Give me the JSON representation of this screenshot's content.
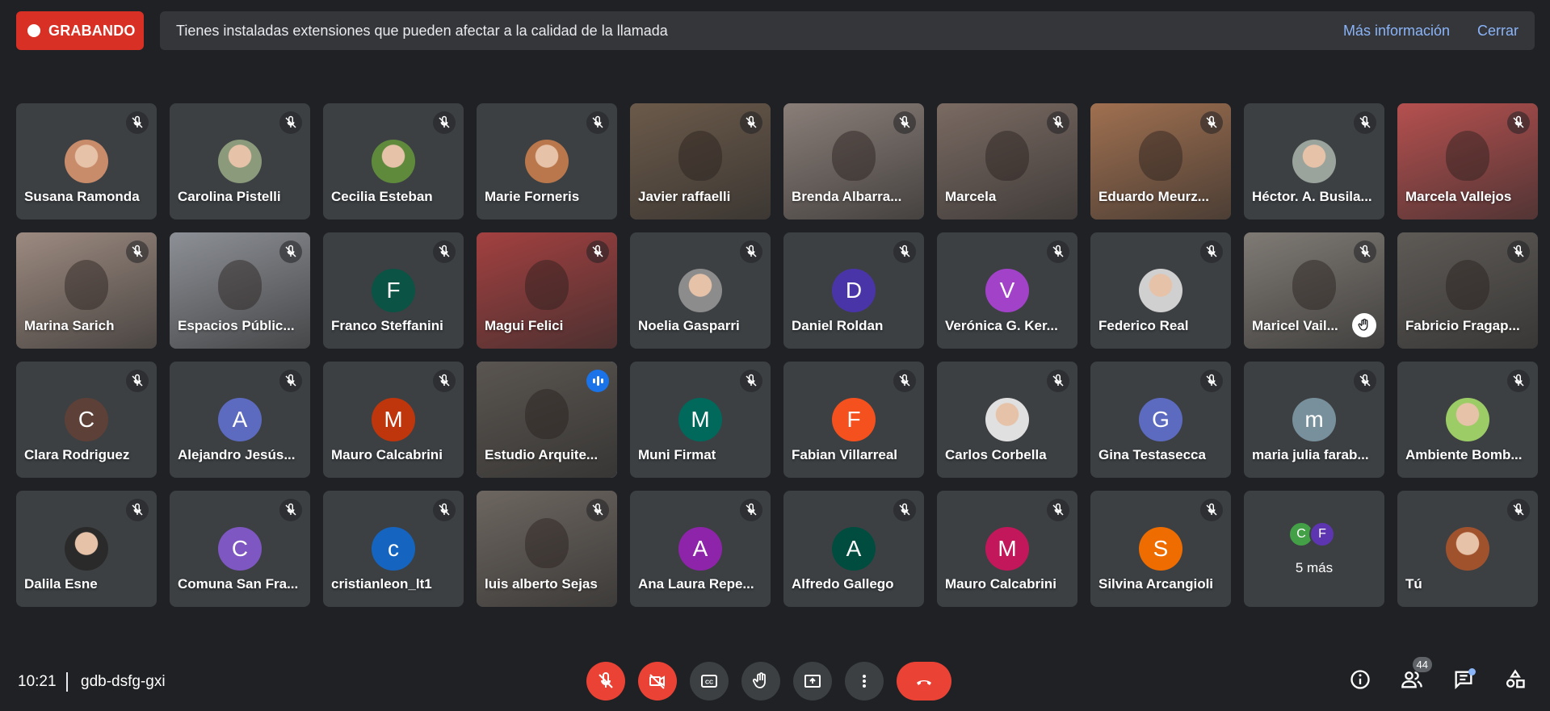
{
  "banner": {
    "recording_label": "GRABANDO",
    "notice_text": "Tienes instaladas extensiones que pueden afectar a la calidad de la llamada",
    "more_info_label": "Más información",
    "close_label": "Cerrar"
  },
  "colors": {
    "record_red": "#d93025",
    "link_blue": "#8ab4f8",
    "tile_bg": "#3c4043",
    "speaking_blue": "#1a73e8"
  },
  "participants": [
    {
      "name": "Susana Ramonda",
      "kind": "photo",
      "color": "#c98c6b"
    },
    {
      "name": "Carolina Pistelli",
      "kind": "photo",
      "color": "#8a9a7a"
    },
    {
      "name": "Cecilia Esteban",
      "kind": "photo",
      "color": "#5f8a3c"
    },
    {
      "name": "Marie Forneris",
      "kind": "photo",
      "color": "#b9774b"
    },
    {
      "name": "Javier raffaelli",
      "kind": "video",
      "color": "#6b5a4a"
    },
    {
      "name": "Brenda Albarra...",
      "kind": "video",
      "color": "#8a7e78"
    },
    {
      "name": "Marcela",
      "kind": "video",
      "color": "#7a6a62"
    },
    {
      "name": "Eduardo Meurz...",
      "kind": "video",
      "color": "#a07050"
    },
    {
      "name": "Héctor. A. Busila...",
      "kind": "photo",
      "color": "#9aa39c"
    },
    {
      "name": "Marcela Vallejos",
      "kind": "video",
      "color": "#b5504f"
    },
    {
      "name": "Marina Sarich",
      "kind": "video",
      "color": "#9c8a80"
    },
    {
      "name": "Espacios Públic...",
      "kind": "video",
      "color": "#8d9096"
    },
    {
      "name": "Franco Steffanini",
      "kind": "letter",
      "letter": "F",
      "color": "#0b5345"
    },
    {
      "name": "Magui Felici",
      "kind": "video",
      "color": "#a34040"
    },
    {
      "name": "Noelia Gasparri",
      "kind": "photo",
      "color": "#8c8c8c"
    },
    {
      "name": "Daniel Roldan",
      "kind": "letter",
      "letter": "D",
      "color": "#4a35a8"
    },
    {
      "name": "Verónica G. Ker...",
      "kind": "letter",
      "letter": "V",
      "color": "#a142c9"
    },
    {
      "name": "Federico Real",
      "kind": "photo",
      "color": "#d0d0d0"
    },
    {
      "name": "Maricel Vail...",
      "kind": "video",
      "color": "#7f7a74",
      "hand": true
    },
    {
      "name": "Fabricio Fragap...",
      "kind": "video",
      "color": "#5e5a56"
    },
    {
      "name": "Clara Rodriguez",
      "kind": "letter",
      "letter": "C",
      "color": "#5d4037"
    },
    {
      "name": "Alejandro Jesús...",
      "kind": "letter",
      "letter": "A",
      "color": "#5c6bc0"
    },
    {
      "name": "Mauro Calcabrini",
      "kind": "letter",
      "letter": "M",
      "color": "#bf360c"
    },
    {
      "name": "Estudio Arquite...",
      "kind": "video",
      "color": "#5a5550",
      "speaking": true
    },
    {
      "name": "Muni Firmat",
      "kind": "letter",
      "letter": "M",
      "color": "#00695c"
    },
    {
      "name": "Fabian Villarreal",
      "kind": "letter",
      "letter": "F",
      "color": "#f4511e"
    },
    {
      "name": "Carlos Corbella",
      "kind": "photo",
      "color": "#e0e0e0"
    },
    {
      "name": "Gina Testasecca",
      "kind": "letter",
      "letter": "G",
      "color": "#5c6bc0"
    },
    {
      "name": "maria julia farab...",
      "kind": "letter",
      "letter": "m",
      "color": "#78909c"
    },
    {
      "name": "Ambiente Bomb...",
      "kind": "photo",
      "color": "#9ccc65"
    },
    {
      "name": "Dalila Esne",
      "kind": "photo",
      "color": "#2a2a2a"
    },
    {
      "name": "Comuna San Fra...",
      "kind": "letter",
      "letter": "C",
      "color": "#7e57c2"
    },
    {
      "name": "cristianleon_lt1",
      "kind": "letter",
      "letter": "c",
      "color": "#1565c0"
    },
    {
      "name": "luis alberto Sejas",
      "kind": "video",
      "color": "#6d6660"
    },
    {
      "name": "Ana Laura Repe...",
      "kind": "letter",
      "letter": "A",
      "color": "#8e24aa"
    },
    {
      "name": "Alfredo Gallego",
      "kind": "letter",
      "letter": "A",
      "color": "#004d40"
    },
    {
      "name": "Mauro Calcabrini",
      "kind": "letter",
      "letter": "M",
      "color": "#c2185b"
    },
    {
      "name": "Silvina Arcangioli",
      "kind": "letter",
      "letter": "S",
      "color": "#ef6c00"
    },
    {
      "name": "5 más",
      "kind": "more",
      "letters": [
        "C",
        "F"
      ],
      "colors": [
        "#43a047",
        "#5e35b1"
      ]
    },
    {
      "name": "Tú",
      "kind": "photo",
      "color": "#a0522d"
    }
  ],
  "footer": {
    "time": "10:21",
    "meeting_code": "gdb-dsfg-gxi",
    "people_count": "44"
  }
}
